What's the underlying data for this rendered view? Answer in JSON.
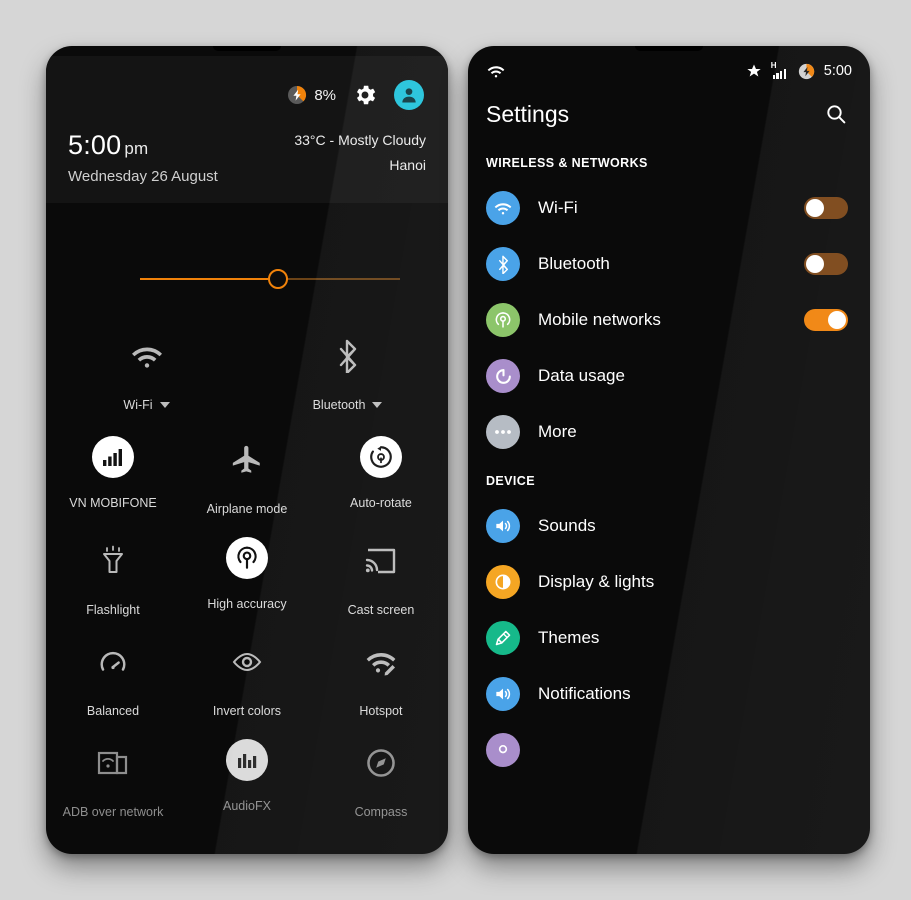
{
  "quick_settings": {
    "status": {
      "battery_percent": "8%",
      "battery_icon": "battery-charging-icon",
      "gear_icon": "gear-icon",
      "avatar_icon": "user-avatar-icon"
    },
    "clock": {
      "time": "5:00",
      "ampm": "pm",
      "date": "Wednesday 26 August"
    },
    "weather": {
      "conditions": "33°C - Mostly Cloudy",
      "city": "Hanoi"
    },
    "brightness": {
      "value_percent": 45
    },
    "tiles_row_a": [
      {
        "label": "Wi-Fi",
        "icon": "wifi-icon",
        "active": false,
        "has_caret": true
      },
      {
        "label": "Bluetooth",
        "icon": "bluetooth-icon",
        "active": false,
        "has_caret": true
      }
    ],
    "tiles": [
      {
        "label": "VN MOBIFONE",
        "icon": "signal-bars-icon",
        "active": true
      },
      {
        "label": "Airplane mode",
        "icon": "airplane-icon",
        "active": false
      },
      {
        "label": "Auto-rotate",
        "icon": "auto-rotate-icon",
        "active": true
      },
      {
        "label": "Flashlight",
        "icon": "flashlight-icon",
        "active": false
      },
      {
        "label": "High accuracy",
        "icon": "location-icon",
        "active": true
      },
      {
        "label": "Cast screen",
        "icon": "cast-screen-icon",
        "active": false
      },
      {
        "label": "Balanced",
        "icon": "performance-gauge-icon",
        "active": false
      },
      {
        "label": "Invert colors",
        "icon": "eye-icon",
        "active": false
      },
      {
        "label": "Hotspot",
        "icon": "hotspot-icon",
        "active": false
      },
      {
        "label": "ADB over network",
        "icon": "adb-network-icon",
        "active": false
      },
      {
        "label": "AudioFX",
        "icon": "equalizer-icon",
        "active": true
      },
      {
        "label": "Compass",
        "icon": "compass-icon",
        "active": false
      }
    ]
  },
  "settings": {
    "status": {
      "wifi_icon": "wifi-icon",
      "star_icon": "star-icon",
      "signal_label": "H",
      "signal_icon": "signal-bars-icon",
      "battery_icon": "battery-charging-icon",
      "clock": "5:00"
    },
    "title": "Settings",
    "search_icon": "search-icon",
    "sections": [
      {
        "header": "WIRELESS & NETWORKS",
        "rows": [
          {
            "label": "Wi-Fi",
            "icon": "wifi-icon",
            "color": "#4aa3e8",
            "toggle": "off"
          },
          {
            "label": "Bluetooth",
            "icon": "bluetooth-icon",
            "color": "#4aa3e8",
            "toggle": "off"
          },
          {
            "label": "Mobile networks",
            "icon": "mobile-network-icon",
            "color": "#8cc56a",
            "toggle": "on"
          },
          {
            "label": "Data usage",
            "icon": "data-usage-icon",
            "color": "#a98ecb",
            "toggle": "none"
          },
          {
            "label": "More",
            "icon": "more-dots-icon",
            "color": "#b6bcc4",
            "toggle": "none"
          }
        ]
      },
      {
        "header": "DEVICE",
        "rows": [
          {
            "label": "Sounds",
            "icon": "speaker-icon",
            "color": "#4aa3e8",
            "toggle": "none"
          },
          {
            "label": "Display & lights",
            "icon": "brightness-contrast-icon",
            "color": "#f5a623",
            "toggle": "none"
          },
          {
            "label": "Themes",
            "icon": "paint-roller-icon",
            "color": "#16b98a",
            "toggle": "none"
          },
          {
            "label": "Notifications",
            "icon": "speaker-icon",
            "color": "#4aa3e8",
            "toggle": "none"
          },
          {
            "label": "",
            "icon": "location-icon",
            "color": "#a98ecb",
            "toggle": "none"
          }
        ]
      }
    ]
  },
  "colors": {
    "accent_orange": "#f0820a",
    "toggle_off_track": "#7a4414",
    "avatar_cyan": "#22c3db",
    "page_background": "#d6d6d6",
    "screen_black": "#0a0a0a"
  }
}
